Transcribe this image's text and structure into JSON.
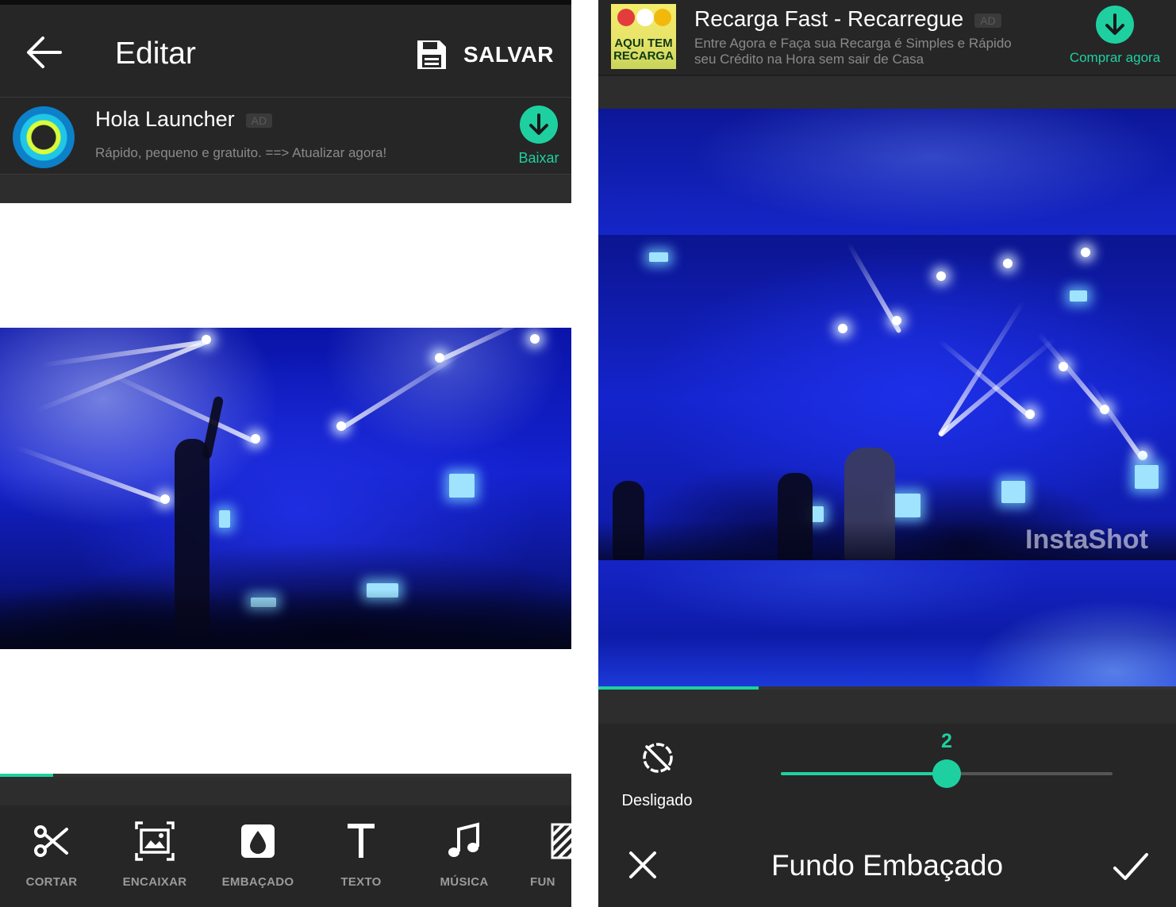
{
  "left": {
    "toolbar": {
      "title": "Editar",
      "save_label": "SALVAR",
      "back_icon": "arrow-left-icon",
      "save_icon": "floppy-disk-icon"
    },
    "ad": {
      "title": "Hola Launcher",
      "badge": "AD",
      "description": "Rápido, pequeno e gratuito. ==> Atualizar agora!",
      "button_label": "Baixar",
      "button_icon": "download-arrow-icon"
    },
    "timeline": {
      "progress": 0.093
    },
    "tools": [
      {
        "label": "CORTAR",
        "icon": "scissors-icon"
      },
      {
        "label": "ENCAIXAR",
        "icon": "fit-frame-icon"
      },
      {
        "label": "EMBAÇADO",
        "icon": "blur-drop-icon"
      },
      {
        "label": "TEXTO",
        "icon": "text-icon"
      },
      {
        "label": "MÚSICA",
        "icon": "music-note-icon"
      },
      {
        "label": "FUN",
        "icon": "pattern-icon"
      }
    ]
  },
  "right": {
    "ad": {
      "title": "Recarga Fast - Recarregue",
      "badge": "AD",
      "description": "Entre Agora e Faça sua Recarga é Simples e Rápido seu Crédito na Hora sem sair de Casa",
      "button_label": "Comprar agora",
      "button_icon": "download-arrow-icon",
      "logo_line1": "AQUI TEM",
      "logo_line2": "RECARGA"
    },
    "watermark": "InstaShot",
    "timeline": {
      "progress": 0.277
    },
    "blur": {
      "off_label": "Desligado",
      "off_icon": "disabled-circle-icon",
      "value": "2",
      "level_fraction": 0.5
    },
    "footer": {
      "title": "Fundo Embaçado",
      "cancel_icon": "close-icon",
      "confirm_icon": "checkmark-icon"
    }
  },
  "colors": {
    "accent": "#1ed0a0",
    "toolbar_bg": "#262626",
    "strip_bg": "#2d2d2d",
    "text_muted": "#8a8a8a"
  }
}
